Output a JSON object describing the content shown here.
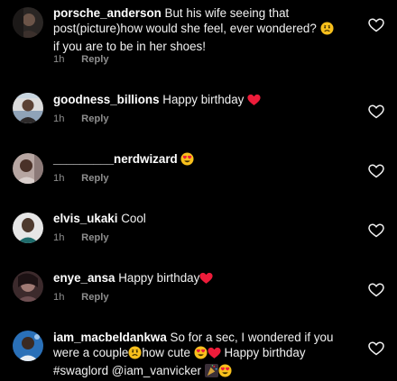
{
  "colors": {
    "background": "#000000",
    "text": "#f2f2f2",
    "muted": "#8e8e8e",
    "heart": "#ed1c3a",
    "emoji_yellow": "#f8c01c"
  },
  "comments": [
    {
      "username": "porsche_anderson",
      "text": "But his wife seeing that post(picture)how would she feel, ever wondered?",
      "text_after_emoji": "if you are to be in her shoes!",
      "emoji": "anxious-face",
      "time": "1h",
      "reply_label": "Reply"
    },
    {
      "username": "goodness_billions",
      "text": "Happy birthday",
      "emoji": "red-heart",
      "time": "1h",
      "reply_label": "Reply"
    },
    {
      "username": "_________nerdwizard",
      "text": "",
      "emoji": "heart-eyes-face",
      "time": "1h",
      "reply_label": "Reply"
    },
    {
      "username": "elvis_ukaki",
      "text": "Cool",
      "time": "1h",
      "reply_label": "Reply"
    },
    {
      "username": "enye_ansa",
      "text": "Happy birthday",
      "emoji": "red-heart",
      "time": "1h",
      "reply_label": "Reply"
    },
    {
      "username": "iam_macbeldankwa",
      "text_part1": "So for a sec, I wondered if you were a couple",
      "text_part2": "how cute",
      "text_part3": "Happy birthday #swaglord @iam_vanvicker",
      "emojis": [
        "anxious-face",
        "heart-eyes-face",
        "red-heart",
        "party-popper",
        "heart-eyes-face"
      ]
    }
  ]
}
